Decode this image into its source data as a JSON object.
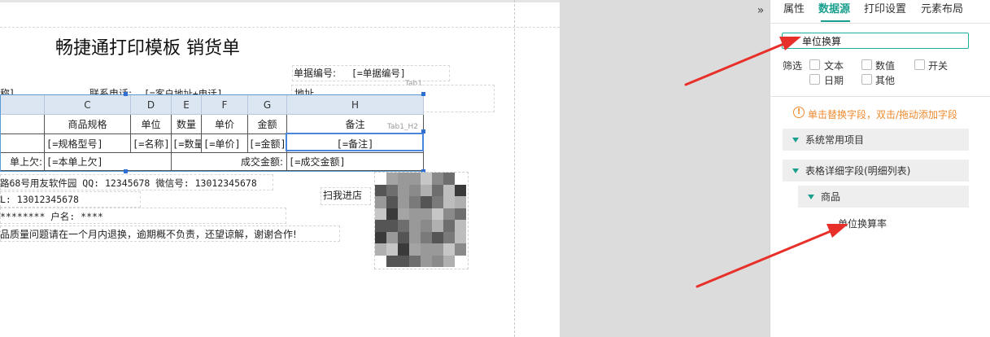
{
  "template": {
    "title": "畅捷通打印模板 销货单",
    "doc_no_label": "单据编号:",
    "doc_no_field": "[=单据编号]",
    "tab1_tag": "Tab1",
    "tab1h2_tag": "Tab1_H2",
    "partial_left": "称]",
    "phone_label": "联系电话:",
    "phone_field": "[=客户地址+电话]",
    "addr_partial": "地址",
    "grid": {
      "col_headers": [
        "C",
        "D",
        "E",
        "F",
        "G",
        "H"
      ],
      "header_cells": [
        "商品规格",
        "单位",
        "数量",
        "单价",
        "金额",
        "备注"
      ],
      "field_cells": [
        "[=规格型号]",
        "[=名称]",
        "[=数量]",
        "[=单价]",
        "[=金额]",
        "[=备注]"
      ],
      "footer_left_label": "单上欠:",
      "footer_left_field": "[=本单上欠]",
      "footer_right_label": "成交金额:",
      "footer_right_field": "[=成交金额]"
    },
    "line_address": "路68号用友软件园 QQ: 12345678 微信号: 13012345678",
    "line_phone": "L: 13012345678",
    "line_account": "******** 户名: ****",
    "line_notice": "品质量问题请在一个月内退换，逾期概不负责，还望谅解，谢谢合作!",
    "qr_label": "扫我进店"
  },
  "panel": {
    "collapse_glyph": "»",
    "tabs": [
      "属性",
      "数据源",
      "打印设置",
      "元素布局"
    ],
    "active_tab": "数据源",
    "search_value": "单位换算",
    "filter_label": "筛选",
    "filters": [
      "文本",
      "数值",
      "开关",
      "日期",
      "其他"
    ],
    "tip_icon": "!",
    "tip": "单击替换字段，双击/拖动添加字段",
    "groups": [
      "系统常用项目",
      "表格详细字段(明细列表)",
      "商品"
    ],
    "result_item": "单位换算率"
  },
  "colors": {
    "accent": "#1a9f8e",
    "tip": "#ee8a2f",
    "arrow": "#e8302a",
    "selection": "#4a86d9"
  }
}
